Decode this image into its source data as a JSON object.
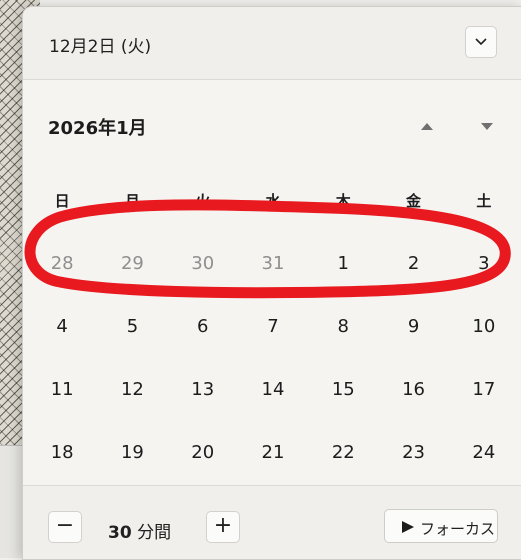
{
  "header": {
    "date_title": "12月2日 (火)",
    "collapse_icon": "chevron-down-icon"
  },
  "calendar": {
    "month_title": "2026年1月",
    "nav_up_icon": "triangle-up-icon",
    "nav_down_icon": "triangle-down-icon",
    "weekdays": [
      "日",
      "月",
      "火",
      "水",
      "木",
      "金",
      "土"
    ],
    "weeks": [
      [
        "28",
        "29",
        "30",
        "31",
        "1",
        "2",
        "3"
      ],
      [
        "4",
        "5",
        "6",
        "7",
        "8",
        "9",
        "10"
      ],
      [
        "11",
        "12",
        "13",
        "14",
        "15",
        "16",
        "17"
      ],
      [
        "18",
        "19",
        "20",
        "21",
        "22",
        "23",
        "24"
      ]
    ]
  },
  "footer": {
    "minus_label": "−",
    "duration_value": "30",
    "duration_unit": "分間",
    "plus_label": "+",
    "focus_label": "フォーカス",
    "focus_icon": "play-icon"
  },
  "colors": {
    "panel_bg": "#f3f2ef",
    "annotation": "#e8191f",
    "other_month_text": "#8f8f8f"
  }
}
